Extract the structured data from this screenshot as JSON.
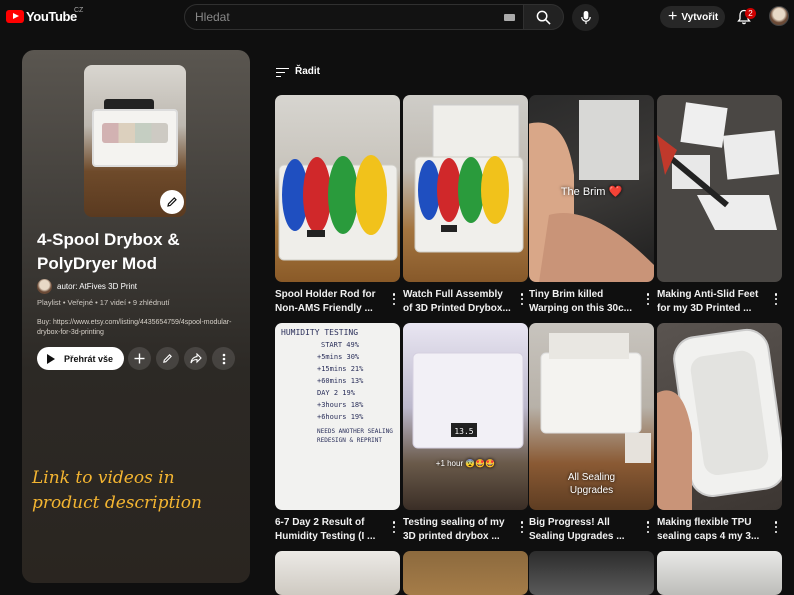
{
  "header": {
    "logo_text": "YouTube",
    "country_code": "CZ",
    "search_placeholder": "Hledat",
    "create_label": "Vytvořit",
    "notification_count": "2"
  },
  "playlist": {
    "title": "4-Spool Drybox & PolyDryer Mod",
    "owner": "autor: AtFives 3D Print",
    "meta": "Playlist • Veřejné • 17 videí • 9 zhlédnutí",
    "description": "Buy: https://www.etsy.com/listing/4435654759/4spool-modular-drybox-for-3d-printing",
    "play_all_label": "Přehrát vše",
    "annotation": "Link to videos in product description"
  },
  "sort_label": "Řadit",
  "videos": [
    {
      "title": "Spool Holder Rod for Non-AMS Friendly ...",
      "overlay": ""
    },
    {
      "title": "Watch Full Assembly of 3D Printed Drybox...",
      "overlay": ""
    },
    {
      "title": "Tiny Brim killed Warping on this 30c...",
      "overlay": "The Brim ❤️"
    },
    {
      "title": "Making Anti-Slid Feet for my 3D Printed ...",
      "overlay": ""
    },
    {
      "title": "6-7 Day 2 Result of Humidity Testing (I ...",
      "overlay": ""
    },
    {
      "title": "Testing sealing of my 3D printed drybox ...",
      "overlay": "+1 hour 😨🤩🤩"
    },
    {
      "title": "Big Progress! All Sealing Upgrades ...",
      "overlay": "All Sealing Upgrades"
    },
    {
      "title": "Making flexible TPU sealing caps 4 my 3...",
      "overlay": ""
    }
  ],
  "whiteboard": {
    "heading": "HUMIDITY TESTING",
    "start": "START 49%",
    "rows": [
      "+5mins 30%",
      "+15mins 21%",
      "+60mins 13%",
      "DAY 2 19%",
      "+3hours 18%",
      "+6hours 19%"
    ],
    "note": "NEEDS ANOTHER SEALING REDESIGN & REPRINT"
  },
  "display_readout": "13.5"
}
